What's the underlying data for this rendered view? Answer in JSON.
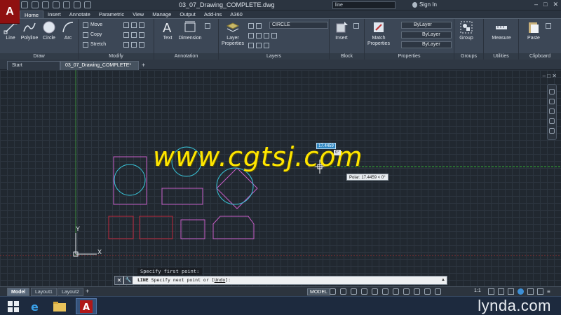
{
  "titlebar": {
    "doc_title": "03_07_Drawing_COMPLETE.dwg",
    "search_value": "line",
    "signin": "Sign In"
  },
  "ribbon_tabs": [
    "Home",
    "Insert",
    "Annotate",
    "Parametric",
    "View",
    "Manage",
    "Output",
    "Add-ins",
    "A360"
  ],
  "ribbon": {
    "draw": {
      "title": "Draw",
      "line": "Line",
      "polyline": "Polyline",
      "circle": "Circle",
      "arc": "Arc"
    },
    "modify": {
      "title": "Modify",
      "move": "Move",
      "copy": "Copy",
      "stretch": "Stretch"
    },
    "annotation": {
      "title": "Annotation",
      "text": "Text",
      "dimension": "Dimension"
    },
    "layers": {
      "title": "Layers",
      "layer_properties": "Layer Properties",
      "current_layer": "CIRCLE"
    },
    "block": {
      "title": "Block",
      "insert": "Insert"
    },
    "properties": {
      "title": "Properties",
      "match": "Match Properties",
      "color": "ByLayer",
      "linetype": "ByLayer",
      "lineweight": "ByLayer"
    },
    "groups": {
      "title": "Groups",
      "group": "Group"
    },
    "utilities": {
      "title": "Utilities",
      "measure": "Measure"
    },
    "clipboard": {
      "title": "Clipboard",
      "paste": "Paste"
    }
  },
  "file_tabs": [
    "Start",
    "03_07_Drawing_COMPLETE*"
  ],
  "canvas": {
    "watermark": "www.cgtsj.com",
    "input_value": "17.4459",
    "angle_value": "0°",
    "polar_tooltip": "Polar: 17.4459 < 0°",
    "axis_x": "X",
    "axis_y": "Y"
  },
  "command": {
    "history": "Specify first point:",
    "prompt_cmd": "LINE",
    "prompt_rest": " Specify next point or [",
    "prompt_option": "Undo",
    "prompt_end": "]:"
  },
  "statusbar": {
    "layout_tabs": [
      "Model",
      "Layout1",
      "Layout2"
    ],
    "model_label": "MODEL",
    "scale": "1:1"
  },
  "taskbar": {
    "brand": "lynda",
    "brand_suffix": ".com"
  },
  "colors": {
    "magenta": "#c85ec8",
    "cyan": "#39c4d8",
    "red": "#c0283c",
    "watermark": "#ffe600",
    "canvas_bg": "#212830"
  }
}
